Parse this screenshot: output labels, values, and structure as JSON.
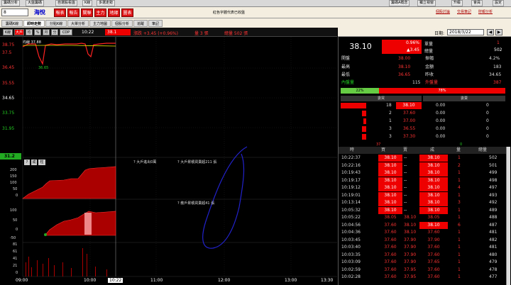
{
  "topbar": {
    "left_items": [
      "籌碼分析",
      "大盤籌碼",
      "自選股看盤",
      "K線",
      "多選走勢"
    ],
    "right_items": [
      "籌碼A概念",
      "獨立視窗",
      "升級",
      "會員",
      "設定"
    ]
  },
  "header": {
    "stock_code": "8",
    "stock_name": "海悅",
    "nav_buttons": [
      "報表",
      "報告",
      "關聯",
      "主力",
      "地緣",
      "圖表"
    ],
    "marquee": "紅色字體代表已收盤",
    "links": [
      "個股討論",
      "交易筆記",
      "財報分析"
    ]
  },
  "tabs": [
    "籌碼K線",
    "即時走勢",
    "分點K線",
    "大單分析",
    "主力地圖",
    "個股分析",
    "追蹤",
    "筆記"
  ],
  "chart_toolbar": {
    "chips": [
      "K線",
      "大戶",
      "均",
      "%",
      "月",
      "分",
      "CDP"
    ],
    "time": "10:22",
    "price_label": "38.1",
    "change": "漲跌 +3.45 (+0.96%)",
    "vol": "量 3 張",
    "total_vol": "總量 502 張"
  },
  "yaxis": [
    "38.75",
    "37.5",
    "36.45",
    "35.55",
    "34.65",
    "33.75",
    "31.95",
    "31.2"
  ],
  "chart_labels": {
    "line_label": "均線 37.88",
    "low_label": "36.65",
    "sub1_buttons": [
      "?",
      "成",
      "柱"
    ],
    "sub1_title": "? 大戶進出0萬",
    "sub1_title2": "? 大戶累積買賣超211 張",
    "sub1_y": [
      "200",
      "150",
      "100",
      "50",
      "0"
    ],
    "sub2_title": "? 散戶累積買賣超41 張",
    "sub2_y": [
      "100",
      "50",
      "0",
      "-50"
    ],
    "vol_y": [
      "81",
      "61",
      "41",
      "21",
      "0"
    ]
  },
  "xaxis": [
    "09:00",
    "10:00",
    "10:22",
    "11:00",
    "12:00",
    "13:00",
    "13:30"
  ],
  "quote": {
    "date_label": "日期:",
    "date": "2018/3/22",
    "price": "38.10",
    "pct": "0.96%",
    "change": "▲3.45",
    "rows": [
      [
        "單量",
        "1"
      ],
      [
        "總量",
        "502"
      ],
      [
        "開盤",
        "38.00",
        "振幅",
        "4.2%"
      ],
      [
        "最高",
        "38.10",
        "金額",
        "183"
      ],
      [
        "最低",
        "36.65",
        "昨收",
        "34.65"
      ],
      [
        "內盤量",
        "115",
        "外盤量",
        "387"
      ]
    ],
    "bar_in": "22%",
    "bar_out": "78%"
  },
  "orderbook": {
    "head_bid": "委買",
    "head_ask": "委賣",
    "rows": [
      [
        "18",
        "38.10",
        "0.00",
        "0"
      ],
      [
        "2",
        "37.60",
        "0.00",
        "0"
      ],
      [
        "1",
        "37.00",
        "0.00",
        "0"
      ],
      [
        "3",
        "36.55",
        "0.00",
        "0"
      ],
      [
        "3",
        "37.30",
        "0.00",
        "0"
      ]
    ],
    "foot": [
      "37",
      "0"
    ]
  },
  "ticks": {
    "headers": [
      "時",
      "買",
      "賣",
      "成",
      "量",
      "總量"
    ],
    "rows": [
      [
        "10:22:37",
        "38.10",
        "--",
        "38.10",
        "1",
        "502"
      ],
      [
        "10:22:16",
        "38.10",
        "--",
        "38.10",
        "2",
        "501"
      ],
      [
        "10:19:43",
        "38.10",
        "--",
        "38.10",
        "1",
        "499"
      ],
      [
        "10:19:17",
        "38.10",
        "--",
        "38.10",
        "1",
        "498"
      ],
      [
        "10:19:12",
        "38.10",
        "--",
        "38.10",
        "4",
        "497"
      ],
      [
        "10:19:01",
        "38.10",
        "--",
        "38.10",
        "1",
        "493"
      ],
      [
        "10:13:14",
        "38.10",
        "--",
        "38.10",
        "3",
        "492"
      ],
      [
        "10:05:32",
        "38.10",
        "--",
        "38.10",
        "1",
        "489"
      ],
      [
        "10:05:22",
        "38.05",
        "38.10",
        "38.05",
        "1",
        "488"
      ],
      [
        "10:04:56",
        "37.60",
        "38.10",
        "38.10",
        "6",
        "487"
      ],
      [
        "10:04:36",
        "37.60",
        "38.10",
        "37.60",
        "1",
        "481"
      ],
      [
        "10:03:45",
        "37.60",
        "37.90",
        "37.90",
        "1",
        "482"
      ],
      [
        "10:03:40",
        "37.60",
        "37.90",
        "37.60",
        "1",
        "481"
      ],
      [
        "10:03:35",
        "37.60",
        "37.90",
        "37.60",
        "1",
        "480"
      ],
      [
        "10:03:09",
        "37.60",
        "37.90",
        "37.65",
        "1",
        "479"
      ],
      [
        "10:02:59",
        "37.60",
        "37.95",
        "37.60",
        "1",
        "478"
      ],
      [
        "10:02:28",
        "37.60",
        "37.95",
        "37.60",
        "1",
        "477"
      ]
    ]
  }
}
